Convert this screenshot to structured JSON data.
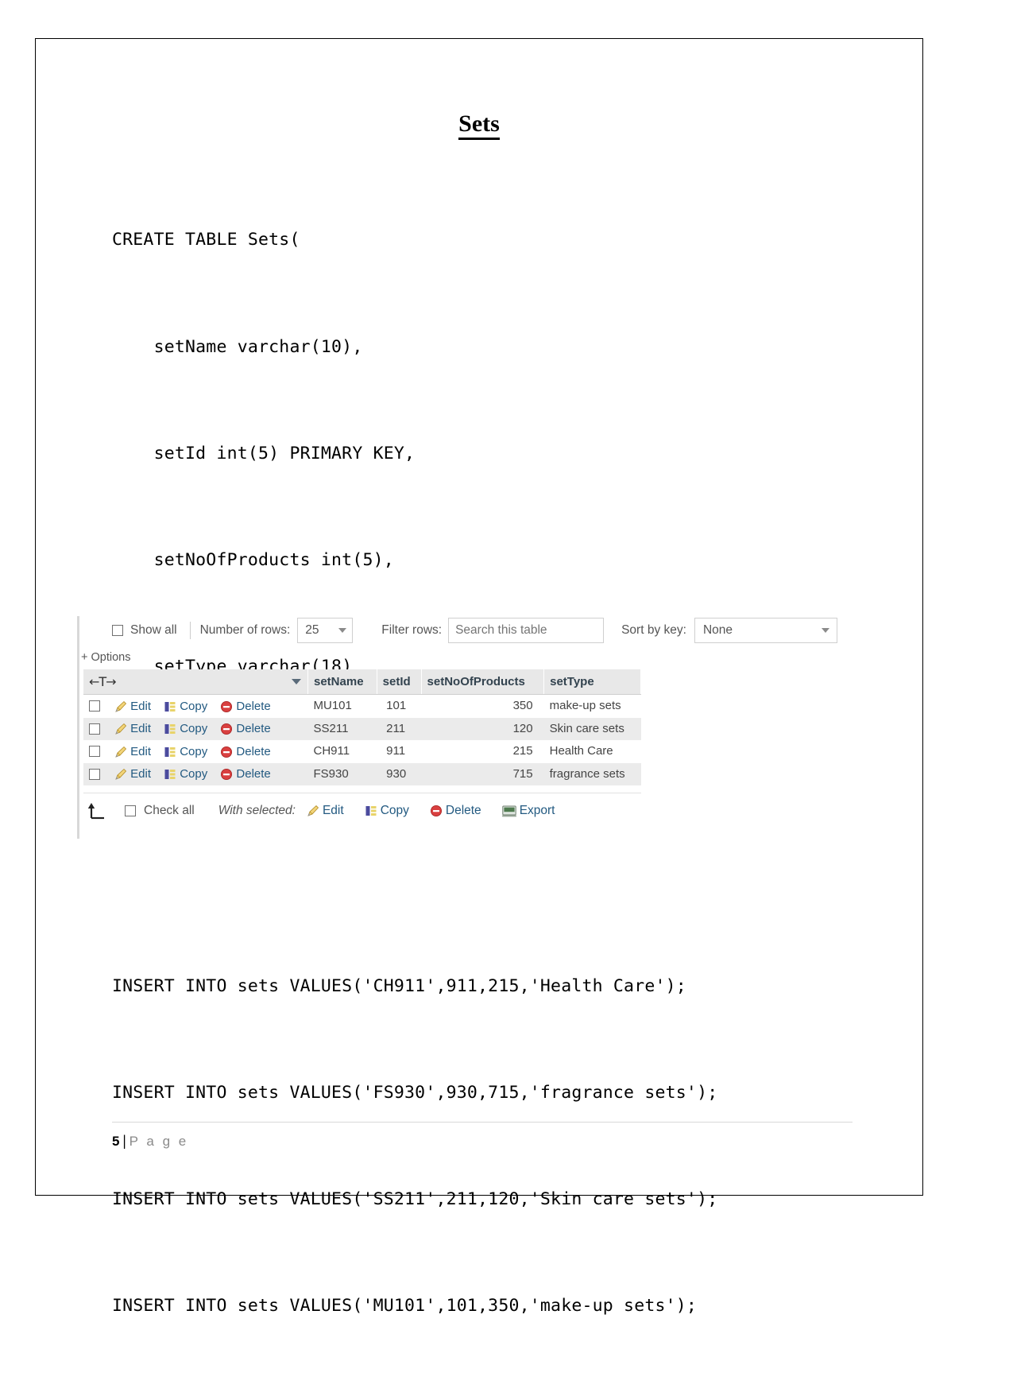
{
  "document": {
    "title": "Sets",
    "page_footer": {
      "number": "5",
      "separator": "|",
      "word": "P a g e"
    }
  },
  "sql": {
    "create_lines": [
      "CREATE TABLE Sets(",
      "    setName varchar(10),",
      "    setId int(5) PRIMARY KEY,",
      "    setNoOfProducts int(5),",
      "    setType varchar(18)",
      ");"
    ],
    "insert_lines": [
      "INSERT INTO sets VALUES('CH911',911,215,'Health Care');",
      "INSERT INTO sets VALUES('FS930',930,715,'fragrance sets');",
      "INSERT INTO sets VALUES('SS211',211,120,'Skin care sets');",
      "INSERT INTO sets VALUES('MU101',101,350,'make-up sets');"
    ]
  },
  "phpmyadmin": {
    "toolbar": {
      "show_all_label": "Show all",
      "number_of_rows_label": "Number of rows:",
      "rows_value": "25",
      "filter_rows_label": "Filter rows:",
      "filter_placeholder": "Search this table",
      "sort_by_key_label": "Sort by key:",
      "sort_value": "None"
    },
    "options_link": "+ Options",
    "columns": [
      "setName",
      "setId",
      "setNoOfProducts",
      "setType"
    ],
    "row_actions": {
      "edit": "Edit",
      "copy": "Copy",
      "delete": "Delete"
    },
    "rows": [
      {
        "setName": "MU101",
        "setId": "101",
        "setNoOfProducts": "350",
        "setType": "make-up sets"
      },
      {
        "setName": "SS211",
        "setId": "211",
        "setNoOfProducts": "120",
        "setType": "Skin care sets"
      },
      {
        "setName": "CH911",
        "setId": "911",
        "setNoOfProducts": "215",
        "setType": "Health Care"
      },
      {
        "setName": "FS930",
        "setId": "930",
        "setNoOfProducts": "715",
        "setType": "fragrance sets"
      }
    ],
    "footer": {
      "check_all_label": "Check all",
      "with_selected_label": "With selected:",
      "edit": "Edit",
      "copy": "Copy",
      "delete": "Delete",
      "export": "Export"
    },
    "colors": {
      "link": "#235a81",
      "header_bg": "#e8e8e8",
      "header_text": "#33434f",
      "alt_row_bg": "#ebebeb"
    }
  }
}
